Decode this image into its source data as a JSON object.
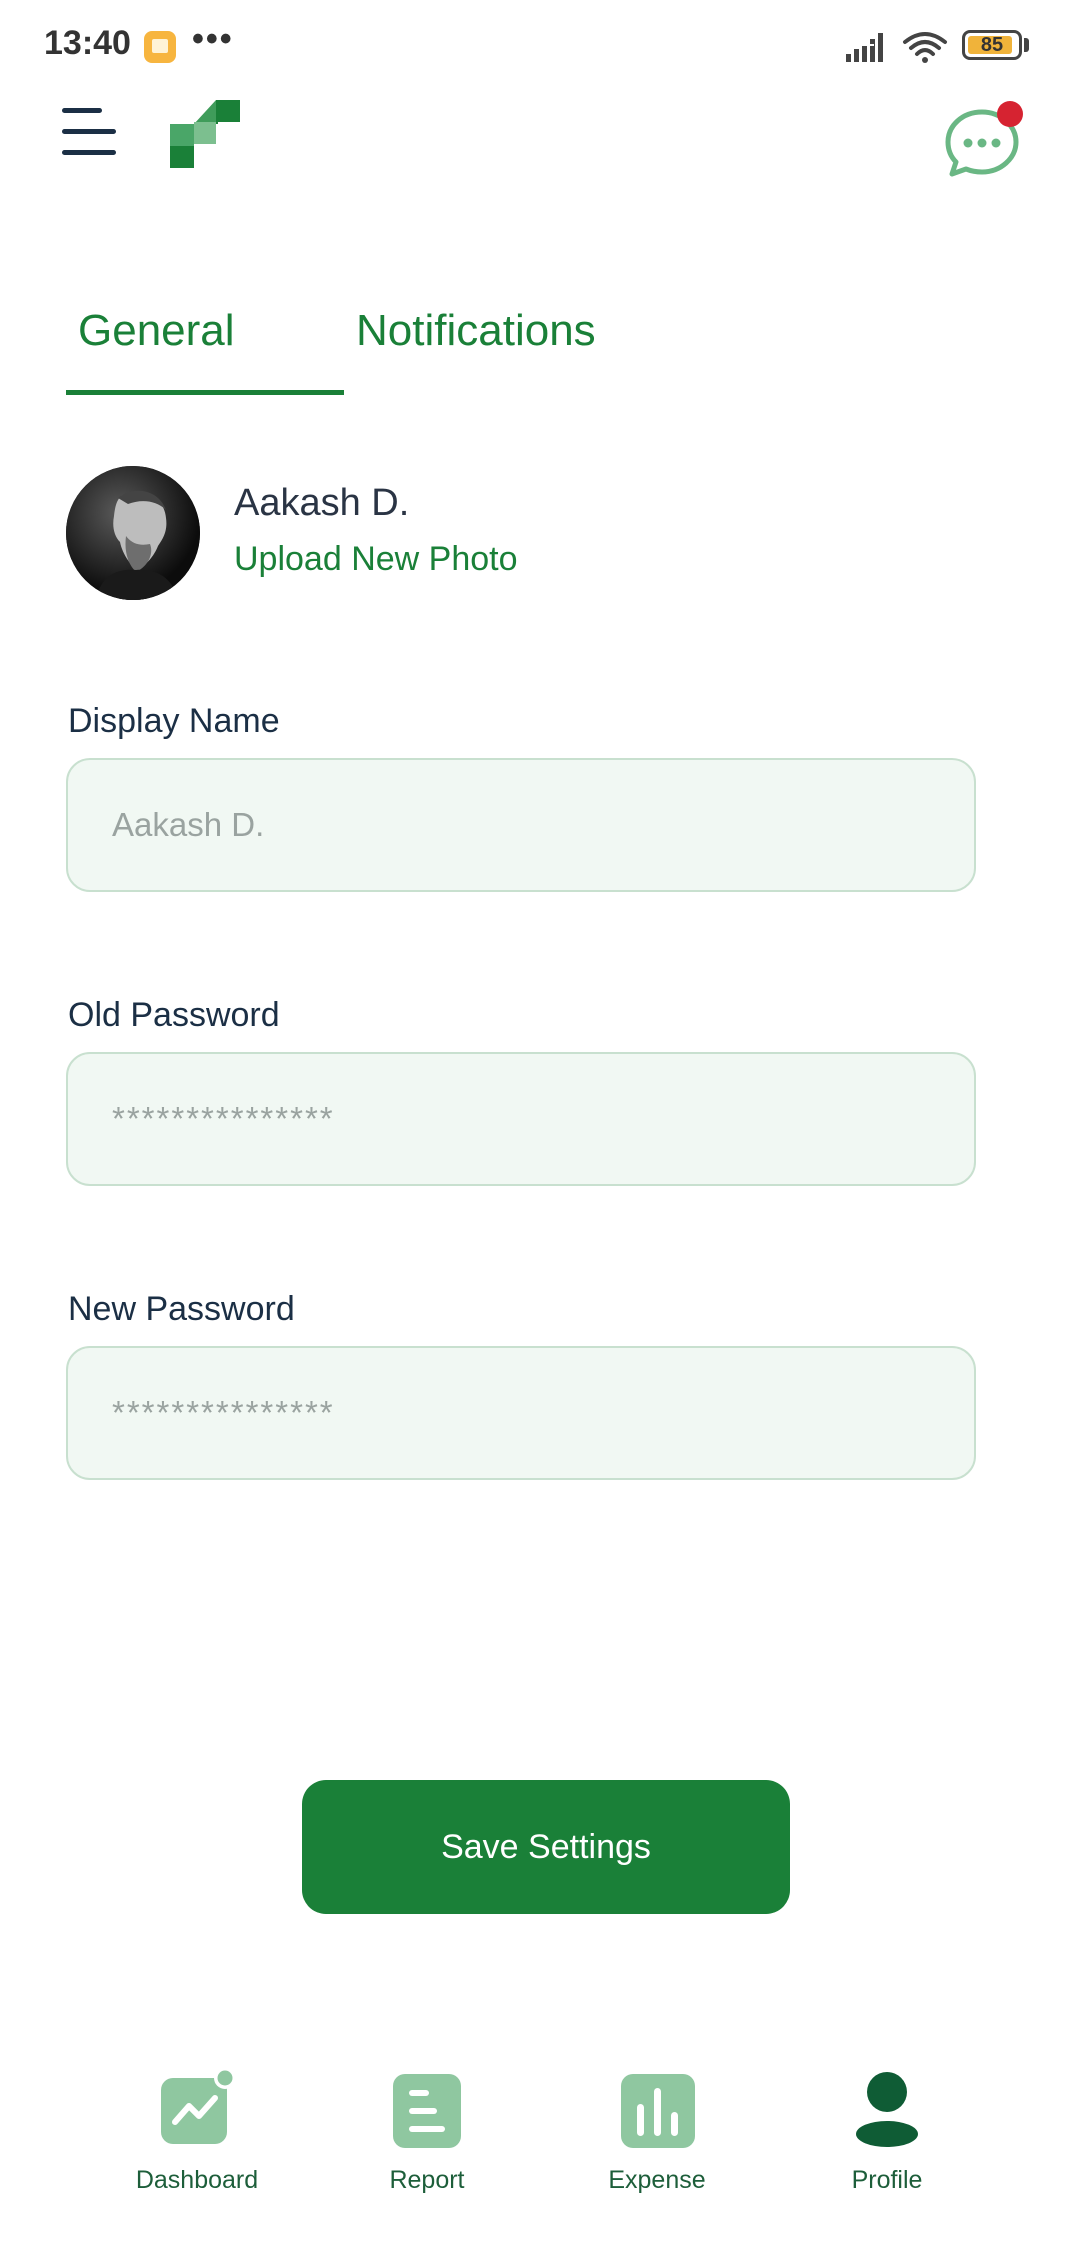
{
  "status_bar": {
    "time": "13:40",
    "dots": "•••",
    "battery_level": "85"
  },
  "header": {
    "menu_icon": "menu-icon",
    "logo": "app-logo",
    "chat_icon": "chat-bubble-icon",
    "has_unread_badge": true
  },
  "tabs": [
    {
      "label": "General",
      "active": true
    },
    {
      "label": "Notifications",
      "active": false
    }
  ],
  "profile": {
    "name": "Aakash D.",
    "upload_label": "Upload New Photo"
  },
  "form": {
    "display_name": {
      "label": "Display Name",
      "placeholder": "Aakash D."
    },
    "old_password": {
      "label": "Old Password",
      "placeholder": "***************"
    },
    "new_password": {
      "label": "New Password",
      "placeholder": "***************"
    }
  },
  "save_button_label": "Save Settings",
  "bottom_nav": [
    {
      "label": "Dashboard",
      "icon": "trend-chart-icon"
    },
    {
      "label": "Report",
      "icon": "report-list-icon"
    },
    {
      "label": "Expense",
      "icon": "bar-chart-icon"
    },
    {
      "label": "Profile",
      "icon": "user-icon",
      "active": true
    }
  ],
  "colors": {
    "primary_green": "#1a8038",
    "field_bg": "#f1f8f3",
    "nav_icon_light": "#8fc7a0",
    "notification_red": "#d62331"
  }
}
